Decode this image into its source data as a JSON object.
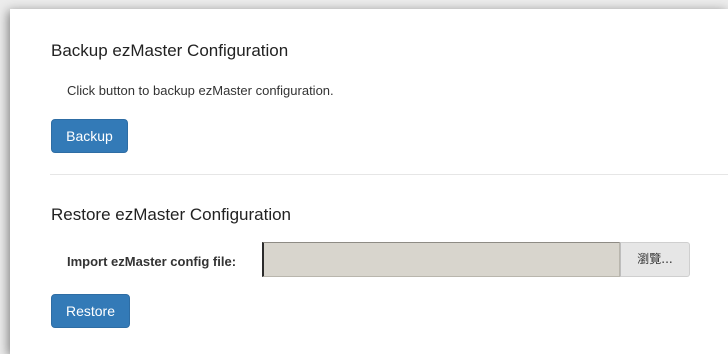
{
  "backup": {
    "title": "Backup ezMaster Configuration",
    "description": "Click button to backup ezMaster configuration.",
    "button_label": "Backup"
  },
  "restore": {
    "title": "Restore ezMaster Configuration",
    "import_label": "Import ezMaster config file:",
    "file_value": "",
    "browse_label": "瀏覽...",
    "button_label": "Restore"
  },
  "colors": {
    "primary_button": "#337ab7",
    "file_field": "#d8d5cd"
  }
}
